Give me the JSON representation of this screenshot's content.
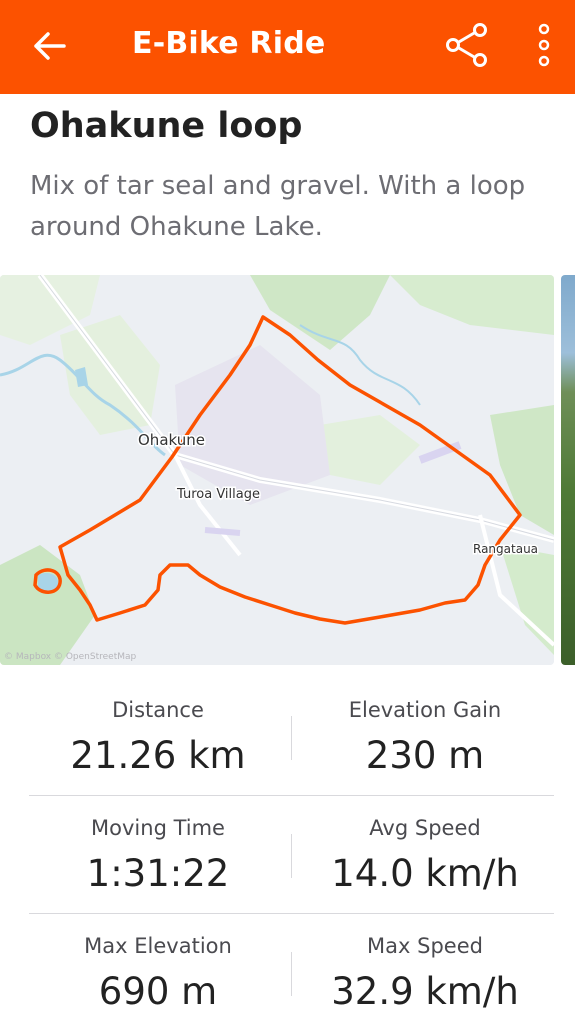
{
  "appbar": {
    "title": "E-Bike Ride",
    "back_icon": "arrow-left-icon",
    "share_icon": "share-icon",
    "more_icon": "more-vertical-icon",
    "background_color": "#fc5200"
  },
  "route": {
    "title": "Ohakune loop",
    "description": "Mix of tar seal and gravel. With a loop around Ohakune Lake."
  },
  "map": {
    "labels": {
      "ohakune": "Ohakune",
      "turoa_village": "Turoa Village",
      "rangataua": "Rangataua"
    },
    "attribution": "© Mapbox © OpenStreetMap",
    "route_color": "#fc5200"
  },
  "stats": [
    {
      "left": {
        "label": "Distance",
        "value": "21.26 km"
      },
      "right": {
        "label": "Elevation Gain",
        "value": "230 m"
      }
    },
    {
      "left": {
        "label": "Moving Time",
        "value": "1:31:22"
      },
      "right": {
        "label": "Avg Speed",
        "value": "14.0 km/h"
      }
    },
    {
      "left": {
        "label": "Max Elevation",
        "value": "690 m"
      },
      "right": {
        "label": "Max Speed",
        "value": "32.9 km/h"
      }
    }
  ]
}
